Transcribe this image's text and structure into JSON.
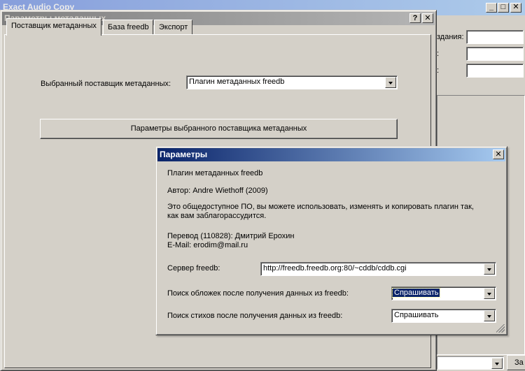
{
  "background_window": {
    "title": "Exact Audio Copy",
    "field_labels": [
      "здания:",
      ":",
      ":"
    ],
    "button_partial": "За"
  },
  "metadata_window": {
    "title": "Параметры метаданных",
    "help_glyph": "?",
    "close_glyph": "✕",
    "tabs": [
      {
        "label": "Поставщик метаданных",
        "active": true
      },
      {
        "label": "База freedb",
        "active": false
      },
      {
        "label": "Экспорт",
        "active": false
      }
    ],
    "provider_label": "Выбранный поставщик метаданных:",
    "provider_value": "Плагин метаданных freedb",
    "provider_settings_button": "Параметры выбранного поставщика метаданных"
  },
  "params_dialog": {
    "title": "Параметры",
    "close_glyph": "✕",
    "plugin_name": "Плагин метаданных freedb",
    "author": "Автор: Andre Wiethoff (2009)",
    "license_line1": "Это общедоступное ПО, вы можете использовать, изменять и копировать плагин так,",
    "license_line2": "как вам заблагорассудится.",
    "translation": "Перевод (110828): Дмитрий Ерохин",
    "email": "E-Mail: erodim@mail.ru",
    "server_label": "Сервер freedb:",
    "server_value": "http://freedb.freedb.org:80/~cddb/cddb.cgi",
    "cover_label": "Поиск обложек после получения данных из freedb:",
    "cover_value": "Спрашивать",
    "lyrics_label": "Поиск стихов после получения данных из freedb:",
    "lyrics_value": "Спрашивать"
  },
  "colors": {
    "active_title": "#0a246a",
    "inactive_title": "#808080",
    "face": "#d4d0c8"
  }
}
